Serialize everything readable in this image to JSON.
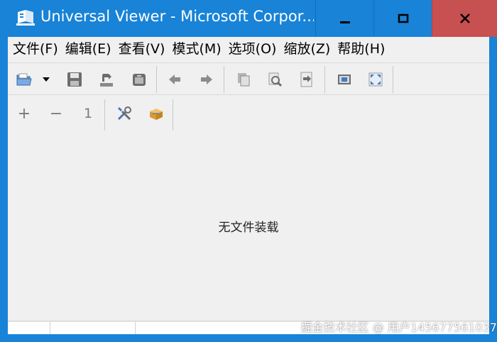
{
  "window": {
    "title": "Universal Viewer - Microsoft Corpor...",
    "controls": {
      "minimize": "minimize",
      "maximize": "maximize",
      "close": "close"
    },
    "colors": {
      "titlebar": "#1883d7",
      "close": "#c75050"
    }
  },
  "menu": {
    "items": [
      {
        "label": "文件(F)"
      },
      {
        "label": "编辑(E)"
      },
      {
        "label": "查看(V)"
      },
      {
        "label": "模式(M)"
      },
      {
        "label": "选项(O)"
      },
      {
        "label": "缩放(Z)"
      },
      {
        "label": "帮助(H)"
      }
    ]
  },
  "toolbar1": {
    "buttons": [
      "open-icon",
      "dropdown-arrow-icon",
      "save-icon",
      "reload-icon",
      "print-icon",
      "back-icon",
      "forward-icon",
      "copy-icon",
      "find-icon",
      "export-icon",
      "fit-window-icon",
      "fullscreen-icon"
    ]
  },
  "toolbar2": {
    "zoom_in": "+",
    "zoom_out": "−",
    "zoom_reset": "1",
    "buttons": [
      "zoom-in-icon",
      "zoom-out-icon",
      "zoom-original-icon",
      "settings-tools-icon",
      "plugin-box-icon"
    ]
  },
  "content": {
    "empty_message": "无文件装载"
  },
  "watermark": {
    "text": "掘金技术社区 @ 用户145677561037"
  }
}
